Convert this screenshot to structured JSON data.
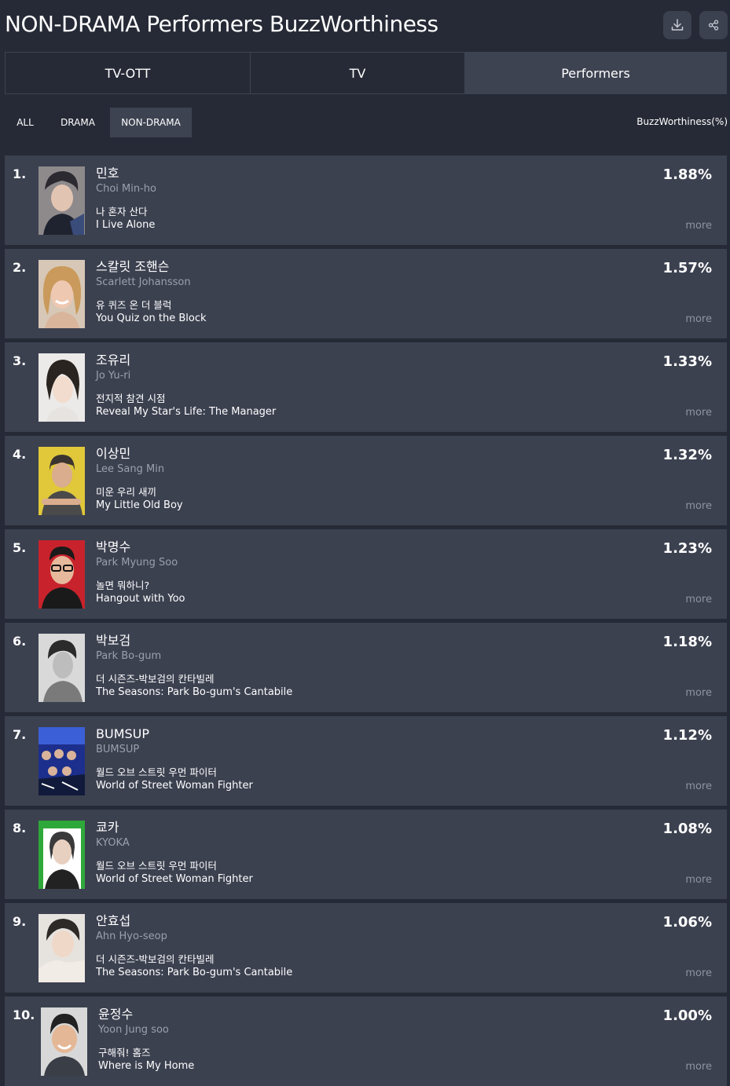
{
  "header": {
    "title": "NON-DRAMA Performers BuzzWorthiness"
  },
  "toolbar": {
    "download_icon": "download-icon",
    "share_icon": "share-icon"
  },
  "tabs": [
    {
      "label": "TV-OTT",
      "active": false
    },
    {
      "label": "TV",
      "active": false
    },
    {
      "label": "Performers",
      "active": true
    }
  ],
  "filters": [
    {
      "label": "ALL",
      "active": false
    },
    {
      "label": "DRAMA",
      "active": false
    },
    {
      "label": "NON-DRAMA",
      "active": true
    }
  ],
  "metric_label": "BuzzWorthiness(%)",
  "more_label": "more",
  "rankings": [
    {
      "rank": "1.",
      "name_ko": "민호",
      "name_en": "Choi Min-ho",
      "show_ko": "나 혼자 산다",
      "show_en": "I Live Alone",
      "value": "1.88%"
    },
    {
      "rank": "2.",
      "name_ko": "스칼릿 조핸슨",
      "name_en": "Scarlett Johansson",
      "show_ko": "유 퀴즈 온 더 블럭",
      "show_en": "You Quiz on the Block",
      "value": "1.57%"
    },
    {
      "rank": "3.",
      "name_ko": "조유리",
      "name_en": "Jo Yu-ri",
      "show_ko": "전지적 참견 시점",
      "show_en": "Reveal My Star's Life: The Manager",
      "value": "1.33%"
    },
    {
      "rank": "4.",
      "name_ko": "이상민",
      "name_en": "Lee Sang Min",
      "show_ko": "미운 우리 새끼",
      "show_en": "My Little Old Boy",
      "value": "1.32%"
    },
    {
      "rank": "5.",
      "name_ko": "박명수",
      "name_en": "Park Myung Soo",
      "show_ko": "놀면 뭐하니?",
      "show_en": "Hangout with Yoo",
      "value": "1.23%"
    },
    {
      "rank": "6.",
      "name_ko": "박보검",
      "name_en": "Park Bo-gum",
      "show_ko": "더 시즌즈-박보검의 칸타빌레",
      "show_en": "The Seasons: Park Bo-gum's Cantabile",
      "value": "1.18%"
    },
    {
      "rank": "7.",
      "name_ko": "BUMSUP",
      "name_en": "BUMSUP",
      "show_ko": "월드 오브 스트릿 우먼 파이터",
      "show_en": "World of Street Woman Fighter",
      "value": "1.12%"
    },
    {
      "rank": "8.",
      "name_ko": "쿄카",
      "name_en": "KYOKA",
      "show_ko": "월드 오브 스트릿 우먼 파이터",
      "show_en": "World of Street Woman Fighter",
      "value": "1.08%"
    },
    {
      "rank": "9.",
      "name_ko": "안효섭",
      "name_en": "Ahn Hyo-seop",
      "show_ko": "더 시즌즈-박보검의 칸타빌레",
      "show_en": "The Seasons: Park Bo-gum's Cantabile",
      "value": "1.06%"
    },
    {
      "rank": "10.",
      "name_ko": "윤정수",
      "name_en": "Yoon Jung soo",
      "show_ko": "구해줘! 홈즈",
      "show_en": "Where is My Home",
      "value": "1.00%"
    }
  ],
  "colors": {
    "background": "#262a36",
    "card": "#3c4150",
    "muted_text": "#9aa0ad"
  }
}
